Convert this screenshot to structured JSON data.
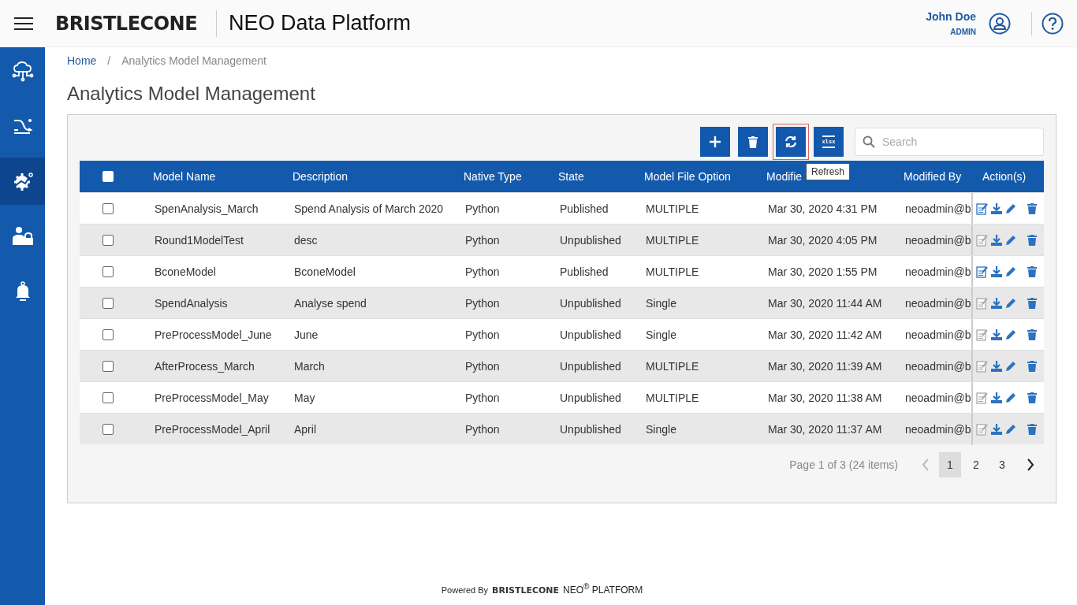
{
  "header": {
    "logo": "BRISTLECONE",
    "app_title": "NEO Data Platform",
    "user": {
      "name": "John Doe",
      "role": "ADMIN"
    }
  },
  "sidebar": {
    "items": [
      {
        "kind": "cloud",
        "selected": false
      },
      {
        "kind": "flows",
        "selected": false
      },
      {
        "kind": "models",
        "selected": true
      },
      {
        "kind": "users",
        "selected": false
      },
      {
        "kind": "alerts",
        "selected": false
      }
    ]
  },
  "breadcrumb": [
    {
      "label": "Home",
      "link": true
    },
    {
      "label": "/",
      "link": false
    },
    {
      "label": "Analytics Model Management",
      "link": false
    }
  ],
  "page_title": "Analytics Model Management",
  "toolbar": {
    "buttons": [
      {
        "kind": "add",
        "focused": false
      },
      {
        "kind": "delete",
        "focused": false
      },
      {
        "kind": "refresh",
        "focused": true
      },
      {
        "kind": "export",
        "focused": false,
        "label": "xlsx"
      }
    ],
    "tooltip": "Refresh",
    "search": {
      "placeholder": "Search"
    }
  },
  "table": {
    "all_checked": false,
    "columns": [
      "Model Name",
      "Description",
      "Native Type",
      "State",
      "Model File Option",
      "Modifie",
      "Modified By",
      "Action(s)"
    ],
    "rows": [
      {
        "checked": false,
        "cells": [
          "SpenAnalysis_March",
          "Spend Analysis of March 2020",
          "Python",
          "Published",
          "MULTIPLE",
          "Mar 30, 2020 4:31 PM",
          "neoadmin@b"
        ],
        "view_disabled": false
      },
      {
        "checked": false,
        "cells": [
          "Round1ModelTest",
          "desc",
          "Python",
          "Unpublished",
          "MULTIPLE",
          "Mar 30, 2020 4:05 PM",
          "neoadmin@b"
        ],
        "view_disabled": true
      },
      {
        "checked": false,
        "cells": [
          "BconeModel",
          "BconeModel",
          "Python",
          "Published",
          "MULTIPLE",
          "Mar 30, 2020 1:55 PM",
          "neoadmin@b"
        ],
        "view_disabled": false
      },
      {
        "checked": false,
        "cells": [
          "SpendAnalysis",
          "Analyse spend",
          "Python",
          "Unpublished",
          "Single",
          "Mar 30, 2020 11:44 AM",
          "neoadmin@b"
        ],
        "view_disabled": true
      },
      {
        "checked": false,
        "cells": [
          "PreProcessModel_June",
          "June",
          "Python",
          "Unpublished",
          "Single",
          "Mar 30, 2020 11:42 AM",
          "neoadmin@b"
        ],
        "view_disabled": true
      },
      {
        "checked": false,
        "cells": [
          "AfterProcess_March",
          "March",
          "Python",
          "Unpublished",
          "MULTIPLE",
          "Mar 30, 2020 11:39 AM",
          "neoadmin@b"
        ],
        "view_disabled": true
      },
      {
        "checked": false,
        "cells": [
          "PreProcessModel_May",
          "May",
          "Python",
          "Unpublished",
          "MULTIPLE",
          "Mar 30, 2020 11:38 AM",
          "neoadmin@b"
        ],
        "view_disabled": true
      },
      {
        "checked": false,
        "cells": [
          "PreProcessModel_April",
          "April",
          "Python",
          "Unpublished",
          "Single",
          "Mar 30, 2020 11:37 AM",
          "neoadmin@b"
        ],
        "view_disabled": true
      }
    ]
  },
  "pagination": {
    "summary": "Page 1 of 3 (24 items)",
    "prev_disabled": true,
    "next_disabled": false,
    "pages": [
      {
        "label": "1",
        "selected": true
      },
      {
        "label": "2",
        "selected": false
      },
      {
        "label": "3",
        "selected": false
      }
    ]
  },
  "footer": {
    "powered_by": "Powered By",
    "logo": "BRISTLECONE",
    "product": "NEO$^{®}$ PLATFORM"
  }
}
